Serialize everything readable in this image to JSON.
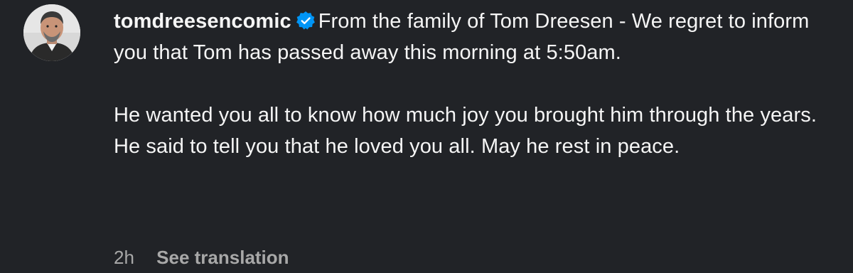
{
  "post": {
    "username": "tomdreesencomic",
    "verified": true,
    "paragraph_1": "From the family of Tom Dreesen - We regret to inform you that Tom has passed away this morning at 5:50am.",
    "paragraph_2": "He wanted you all to know how much joy you brought him through the years. He said to tell you that he loved you all. May he rest in peace.",
    "time_ago": "2h",
    "translate_label": "See translation"
  },
  "colors": {
    "background": "#212327",
    "text": "#f5f5f5",
    "muted": "#a8a8a8",
    "verified_badge": "#0095f6"
  },
  "icons": {
    "avatar": "profile-photo",
    "badge": "verified-badge-icon"
  }
}
